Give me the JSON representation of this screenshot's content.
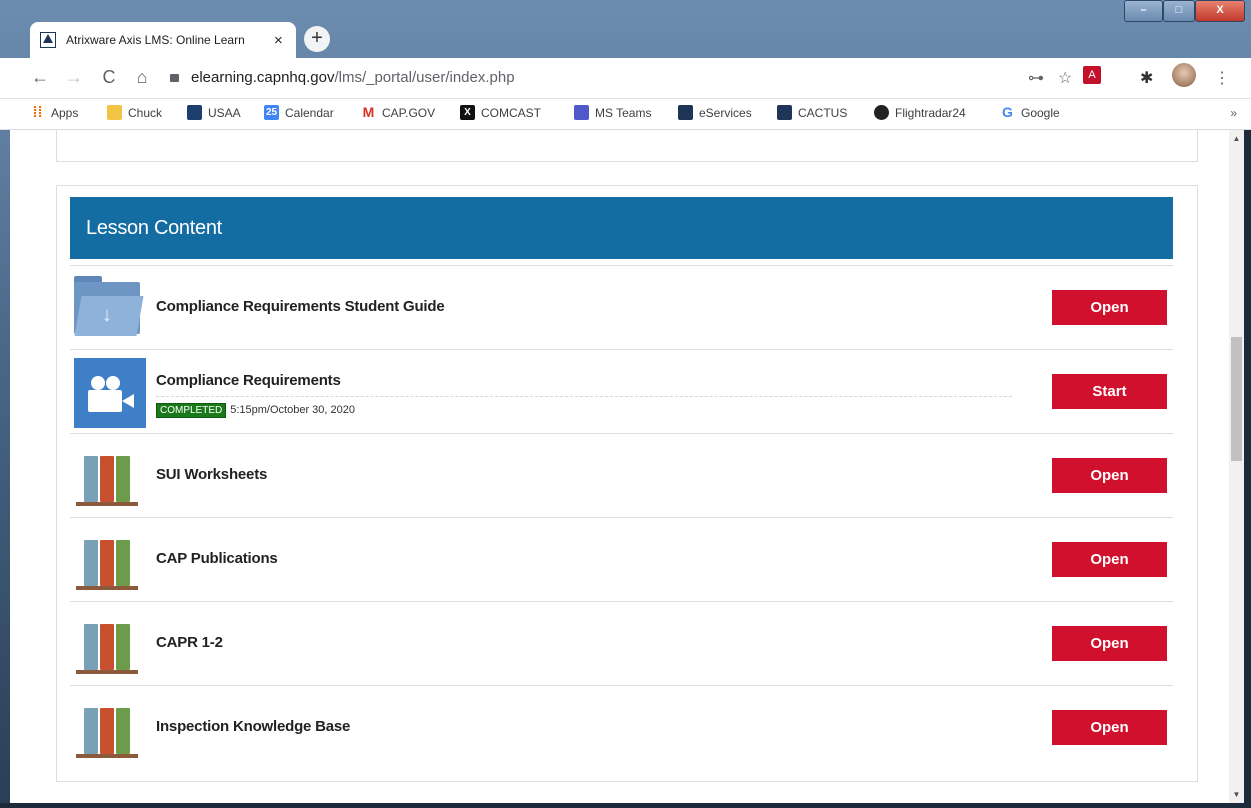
{
  "browser": {
    "tab_title": "Atrixware Axis LMS: Online Learn",
    "tab_close": "×",
    "new_tab": "+",
    "url_domain": "elearning.capnhq.gov",
    "url_path": "/lms/_portal/user/index.php",
    "nav": {
      "back": "←",
      "forward": "→",
      "reload": "C",
      "home": "⌂"
    },
    "toolbar_icons": {
      "key": "⊶",
      "star": "☆",
      "pdf": "A",
      "extensions": "✱",
      "menu": "⋮"
    },
    "window_controls": {
      "minimize": "–",
      "maximize": "□",
      "close": "X"
    }
  },
  "bookmarks": [
    {
      "label": "Apps",
      "icon": "apps-grid-icon",
      "color": "#e8710a"
    },
    {
      "label": "Chuck",
      "icon": "folder-icon",
      "color": "#f3c343"
    },
    {
      "label": "USAA",
      "icon": "usaa-icon",
      "color": "#1c3f6e"
    },
    {
      "label": "Calendar",
      "icon": "calendar-icon",
      "color": "#4285f4"
    },
    {
      "label": "CAP.GOV",
      "icon": "gmail-icon",
      "color": "#d93025"
    },
    {
      "label": "COMCAST",
      "icon": "x-icon",
      "color": "#111111"
    },
    {
      "label": "MS Teams",
      "icon": "teams-icon",
      "color": "#5059c9"
    },
    {
      "label": "eServices",
      "icon": "cap-icon",
      "color": "#1f3558"
    },
    {
      "label": "CACTUS",
      "icon": "cap-icon",
      "color": "#1f3558"
    },
    {
      "label": "Flightradar24",
      "icon": "flightradar-icon",
      "color": "#222222"
    },
    {
      "label": "Google",
      "icon": "google-icon",
      "color": "#4285f4"
    }
  ],
  "bookmarks_more": "»",
  "lesson": {
    "header": "Lesson Content",
    "items": [
      {
        "title": "Compliance Requirements Student Guide",
        "action": "Open",
        "icon": "folder-download-icon"
      },
      {
        "title": "Compliance Requirements",
        "action": "Start",
        "icon": "video-camera-icon",
        "status": "COMPLETED",
        "timestamp": "5:15pm/October 30, 2020"
      },
      {
        "title": "SUI Worksheets",
        "action": "Open",
        "icon": "books-icon"
      },
      {
        "title": "CAP Publications",
        "action": "Open",
        "icon": "books-icon"
      },
      {
        "title": "CAPR 1-2",
        "action": "Open",
        "icon": "books-icon"
      },
      {
        "title": "Inspection Knowledge Base",
        "action": "Open",
        "icon": "books-icon"
      }
    ]
  },
  "colors": {
    "header_blue": "#136ca2",
    "action_red": "#d0102c",
    "completed_green": "#1a7a1a"
  }
}
